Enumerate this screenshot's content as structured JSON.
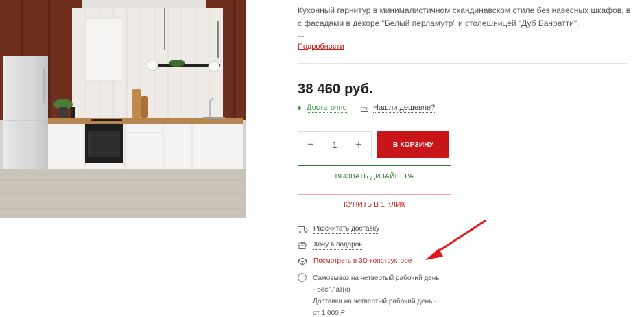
{
  "product": {
    "image_alt": "Кухонный гарнитур",
    "description": "Кухонный гарнитур в минималистичном скандинавском стиле без навесных шкафов, в с фасадами в декоре \"Белый перламутр\" и столешницей \"Дуб Банратти\".",
    "ellipsis": "...",
    "more_link": "Подробности",
    "price": "38 460 руб.",
    "stock_label": "Достаточно",
    "cheaper_label": "Нашли дешевле?"
  },
  "purchase": {
    "qty_minus": "−",
    "qty_value": "1",
    "qty_plus": "+",
    "cart_button": "В КОРЗИНУ",
    "designer_button": "ВЫЗВАТЬ ДИЗАЙНЕРА",
    "one_click_button": "КУПИТЬ В 1 КЛИК"
  },
  "links": {
    "delivery": "Рассчитать доставку",
    "gift": "Хочу в подарок",
    "constructor_3d": "Посмотреть в 3D-конструкторе"
  },
  "info": {
    "line1": "Самовывоз на четвертый рабочий день",
    "line2": "- бесплатно",
    "line3": "Доставка на четвертый рабочий день -",
    "line4": "от 1 000 ₽"
  },
  "colors": {
    "accent_red": "#c8151a",
    "green": "#2e7d32",
    "stock_green": "#38a540"
  }
}
